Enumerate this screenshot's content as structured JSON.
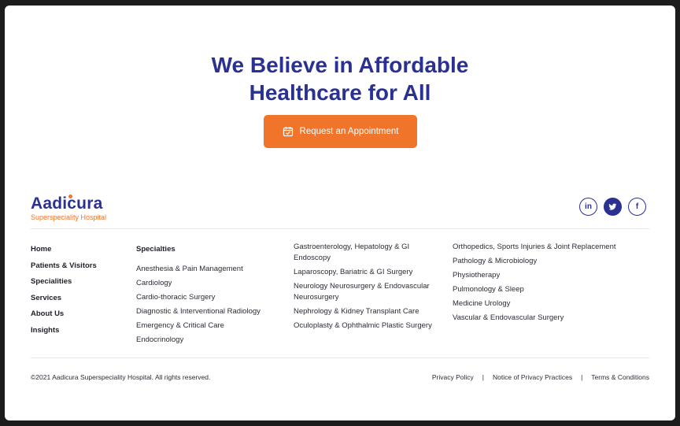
{
  "hero": {
    "title_line1": "We Believe in Affordable",
    "title_line2": "Healthcare for All",
    "cta_label": "Request an Appointment",
    "cta_icon": "calendar-check-icon"
  },
  "brand": {
    "name": "Aadicura",
    "tagline": "Superspeciality Hospital",
    "primary_color": "#2a3190",
    "accent_color": "#f0742a"
  },
  "socials": [
    {
      "label": "in",
      "icon": "linkedin-icon"
    },
    {
      "label": "twitter",
      "icon": "twitter-icon"
    },
    {
      "label": "f",
      "icon": "facebook-icon"
    }
  ],
  "nav": [
    "Home",
    "Patients & Visitors",
    "Specialities",
    "Services",
    "About Us",
    "Insights"
  ],
  "specialties": {
    "heading": "Specialties",
    "col1": [
      "Anesthesia & Pain Management",
      "Cardiology",
      "Cardio-thoracic Surgery",
      "Diagnostic & Interventional Radiology",
      "Emergency & Critical Care",
      "Endocrinology"
    ],
    "col2": [
      "Gastroenterology, Hepatology & GI Endoscopy",
      "Laparoscopy, Bariatric & GI Surgery",
      "Neurology Neurosurgery & Endovascular Neurosurgery",
      "Nephrology & Kidney Transplant Care",
      "Oculoplasty & Ophthalmic Plastic Surgery"
    ],
    "col3": [
      "Orthopedics, Sports Injuries & Joint Replacement",
      "Pathology & Microbiology",
      "Physiotherapy",
      "Pulmonology & Sleep",
      "Medicine Urology",
      "Vascular & Endovascular Surgery"
    ]
  },
  "footer": {
    "copyright": "©2021 Aadicura Superspeciality Hospital. All rights reserved.",
    "privacy": "Privacy Policy",
    "notice": "Notice of Privacy Practices",
    "terms": "Terms & Conditions",
    "separator": "|"
  }
}
